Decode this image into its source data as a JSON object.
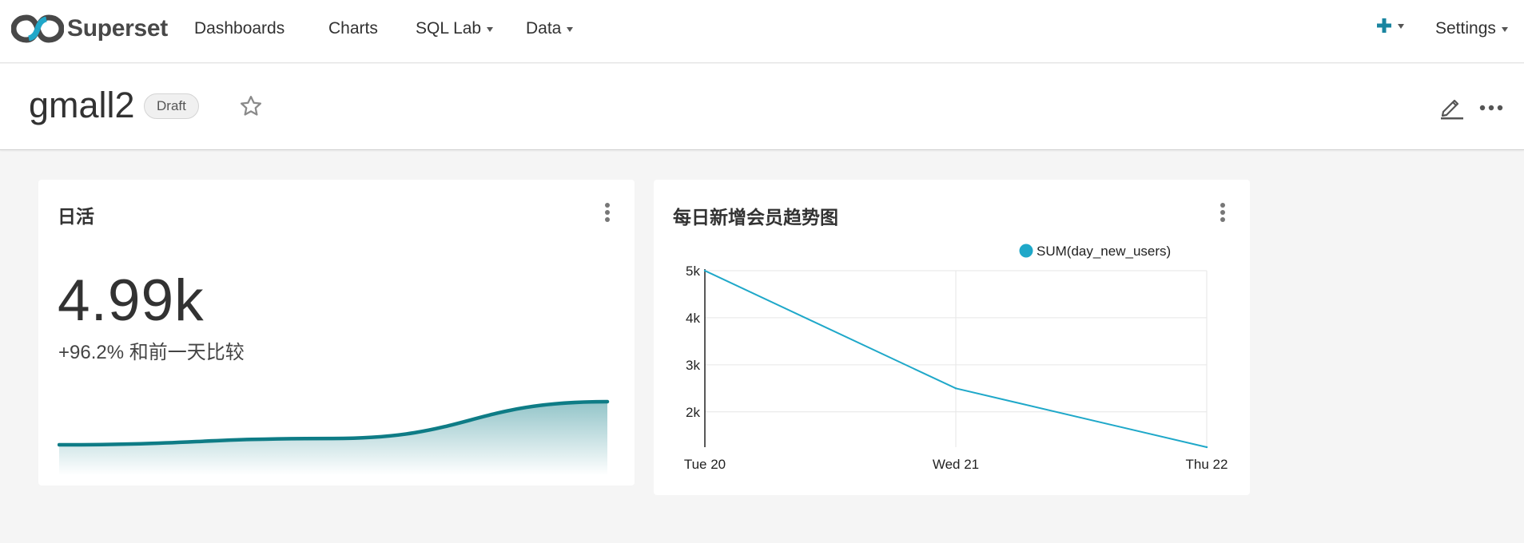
{
  "navbar": {
    "brand": "Superset",
    "items": [
      {
        "label": "Dashboards",
        "dropdown": false
      },
      {
        "label": "Charts",
        "dropdown": false
      },
      {
        "label": "SQL Lab",
        "dropdown": true
      },
      {
        "label": "Data",
        "dropdown": true
      }
    ],
    "settings_label": "Settings"
  },
  "dashboard": {
    "title": "gmall2",
    "status_badge": "Draft"
  },
  "cards": {
    "big_number": {
      "title": "日活",
      "value": "4.99k",
      "subheader": "+96.2% 和前一天比较",
      "sparkline_color": "#0e7c86"
    },
    "trend": {
      "title": "每日新增会员趋势图"
    }
  },
  "chart_data": [
    {
      "type": "area",
      "chart": "sparkline",
      "x": [
        "Tue 20",
        "Wed 21",
        "Thu 22"
      ],
      "values": [
        2540,
        2900,
        4990
      ]
    },
    {
      "type": "line",
      "categories": [
        "Tue 20",
        "Wed 21",
        "Thu 22"
      ],
      "series": [
        {
          "name": "SUM(day_new_users)",
          "values": [
            5000,
            2500,
            1250
          ],
          "color": "#1fa8c9"
        }
      ],
      "yticks": [
        "2k",
        "3k",
        "4k",
        "5k"
      ],
      "ylim": [
        1250,
        5000
      ],
      "grid": true,
      "legend": "top-right"
    }
  ],
  "colors": {
    "accent": "#1a85a0",
    "line": "#1fa8c9",
    "sparkline": "#0e7c86"
  }
}
